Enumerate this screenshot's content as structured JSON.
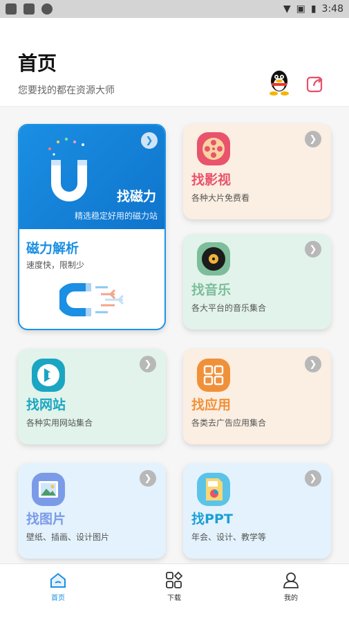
{
  "status_bar": {
    "time": "3:48"
  },
  "header": {
    "title": "首页",
    "subtitle": "您要找的都在资源大师"
  },
  "magnet_card": {
    "title": "找磁力",
    "subtitle": "精选稳定好用的磁力站",
    "parse_title": "磁力解析",
    "parse_desc": "速度快，限制少"
  },
  "cards": [
    {
      "title": "找影视",
      "desc": "各种大片免费看",
      "icon": "film-reel-icon",
      "color": "#e9536b"
    },
    {
      "title": "找音乐",
      "desc": "各大平台的音乐集合",
      "icon": "vinyl-record-icon",
      "color": "#7dbd9a"
    },
    {
      "title": "找网站",
      "desc": "各种实用网站集合",
      "icon": "website-icon",
      "color": "#1aa6c2"
    },
    {
      "title": "找应用",
      "desc": "各类去广告应用集合",
      "icon": "app-grid-icon",
      "color": "#f0913a"
    },
    {
      "title": "找图片",
      "desc": "壁纸、插画、设计图片",
      "icon": "image-icon",
      "color": "#7b9be8"
    },
    {
      "title": "找PPT",
      "desc": "年会、设计、教学等",
      "icon": "ppt-file-icon",
      "color": "#1d9fd4"
    }
  ],
  "bottom_nav": [
    {
      "label": "首页",
      "icon": "home-icon",
      "active": true
    },
    {
      "label": "下载",
      "icon": "download-grid-icon",
      "active": false
    },
    {
      "label": "我的",
      "icon": "profile-icon",
      "active": false
    }
  ]
}
